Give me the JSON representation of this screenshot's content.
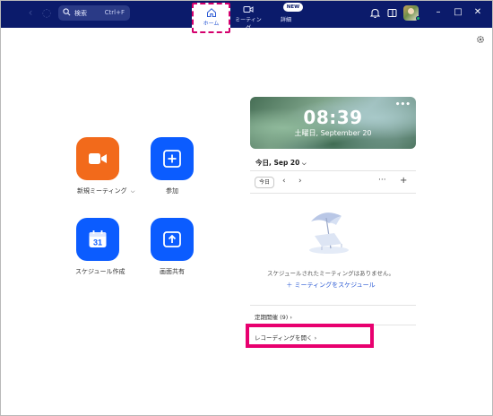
{
  "titlebar": {
    "search": {
      "label": "検索",
      "shortcut": "Ctrl+F"
    },
    "nav": {
      "home": "ホーム",
      "meetings": "ミーティング",
      "more": "詳細",
      "new_badge": "NEW"
    },
    "colors": {
      "bar": "#0b1b6b",
      "accent": "#2d5bd4",
      "highlight": "#d4006d"
    }
  },
  "actions": {
    "new_meeting": "新規ミーティング",
    "join": "参加",
    "schedule": "スケジュール作成",
    "calendar_day": "31",
    "share_screen": "画面共有"
  },
  "clock": {
    "time": "08:39",
    "date": "土曜日, September 20"
  },
  "calendar": {
    "header": "今日, Sep 20",
    "today_button": "今日",
    "prev": "‹",
    "next": "›",
    "more": "···",
    "add": "+",
    "empty_message": "スケジュールされたミーティングはありません。",
    "schedule_link": "＋ ミーティングをスケジュール",
    "recurring": "定期開催 (9)  ›",
    "recordings": "レコーディングを開く  ›"
  }
}
